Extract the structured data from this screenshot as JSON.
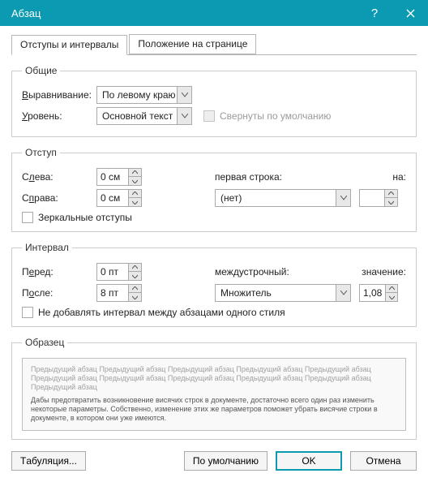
{
  "titlebar": {
    "title": "Абзац"
  },
  "tabs": {
    "indent_spacing": "Отступы и интервалы",
    "position": "Положение на странице"
  },
  "general": {
    "legend": "Общие",
    "alignment_label": "Выравнивание:",
    "alignment_value": "По левому краю",
    "level_label": "Уровень:",
    "level_value": "Основной текст",
    "collapsed_label": "Свернуты по умолчанию"
  },
  "indent": {
    "legend": "Отступ",
    "left_label": "Слева:",
    "left_value": "0 см",
    "right_label": "Справа:",
    "right_value": "0 см",
    "first_line_label": "первая строка:",
    "first_line_value": "(нет)",
    "by_label": "на:",
    "by_value": "",
    "mirror_label": "Зеркальные отступы"
  },
  "spacing": {
    "legend": "Интервал",
    "before_label": "Перед:",
    "before_value": "0 пт",
    "after_label": "После:",
    "after_value": "8 пт",
    "line_label": "междустрочный:",
    "line_value": "Множитель",
    "at_label": "значение:",
    "at_value": "1,08",
    "no_space_label": "Не добавлять интервал между абзацами одного стиля"
  },
  "preview": {
    "legend": "Образец",
    "grey": "Предыдущий абзац Предыдущий абзац Предыдущий абзац Предыдущий абзац Предыдущий абзац Предыдущий абзац Предыдущий абзац Предыдущий абзац Предыдущий абзац Предыдущий абзац Предыдущий абзац",
    "dark": "Дабы предотвратить возникновение висячих строк в документе, достаточно всего один раз изменить некоторые параметры. Собственно, изменение этих же параметров поможет убрать висячие строки в документе, в котором они уже имеются."
  },
  "buttons": {
    "tabs": "Табуляция...",
    "default": "По умолчанию",
    "ok": "OK",
    "cancel": "Отмена"
  }
}
